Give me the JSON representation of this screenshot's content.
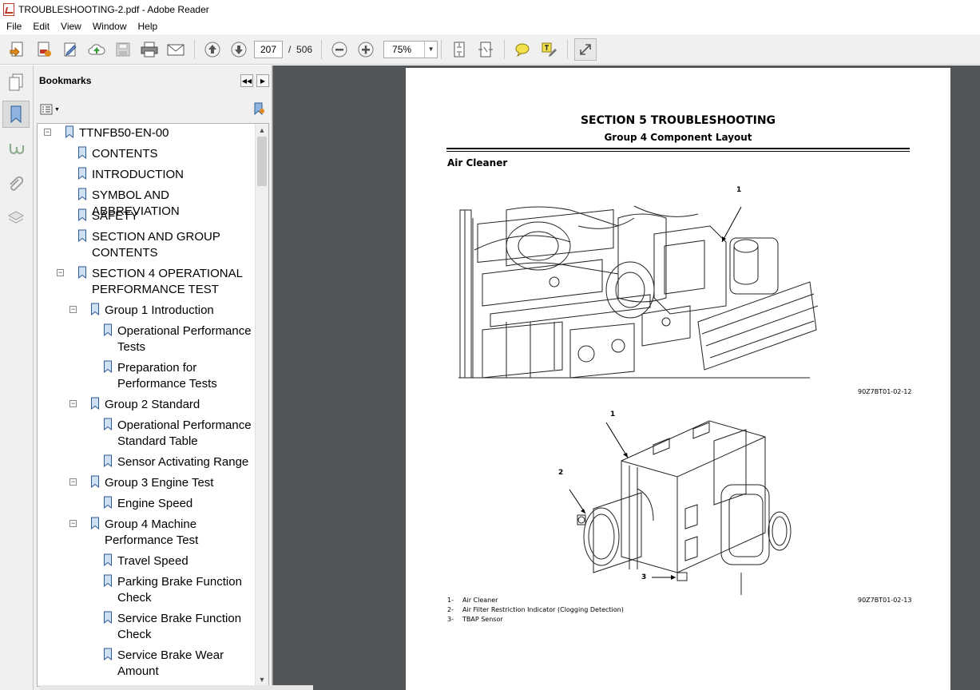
{
  "window": {
    "title": "TROUBLESHOOTING-2.pdf - Adobe Reader"
  },
  "menu": [
    "File",
    "Edit",
    "View",
    "Window",
    "Help"
  ],
  "toolbar": {
    "page_current": "207",
    "page_separator": "/",
    "page_total": "506",
    "zoom": "75%"
  },
  "bookmarks": {
    "title": "Bookmarks",
    "items": [
      {
        "label": "TTNFB50-EN-00"
      },
      {
        "label": "CONTENTS"
      },
      {
        "label": "INTRODUCTION"
      },
      {
        "label": "SYMBOL AND ABBREVIATION"
      },
      {
        "label": "SAFETY"
      },
      {
        "label": "SECTION AND GROUP",
        "label2": "CONTENTS"
      },
      {
        "label": "SECTION 4 OPERATIONAL",
        "label2": "PERFORMANCE TEST"
      },
      {
        "label": "Group 1 Introduction"
      },
      {
        "label": "Operational Performance",
        "label2": "Tests"
      },
      {
        "label": "Preparation for",
        "label2": "Performance Tests"
      },
      {
        "label": "Group 2 Standard"
      },
      {
        "label": "Operational Performance",
        "label2": "Standard Table"
      },
      {
        "label": "Sensor Activating Range"
      },
      {
        "label": "Group 3 Engine Test"
      },
      {
        "label": "Engine Speed"
      },
      {
        "label": "Group 4 Machine",
        "label2": "Performance Test"
      },
      {
        "label": "Travel Speed"
      },
      {
        "label": "Parking Brake Function",
        "label2": "Check"
      },
      {
        "label": "Service Brake Function",
        "label2": "Check"
      },
      {
        "label": "Service Brake Wear",
        "label2": "Amount"
      }
    ]
  },
  "document": {
    "section_title": "SECTION 5 TROUBLESHOOTING",
    "group_title": "Group 4 Component Layout",
    "subheading": "Air Cleaner",
    "figure1": {
      "code": "90Z7BT01-02-12",
      "callout": "1"
    },
    "figure2": {
      "code": "90Z7BT01-02-13",
      "callouts": [
        "1",
        "2",
        "3"
      ]
    },
    "legend": [
      {
        "num": "1-",
        "text": "Air Cleaner"
      },
      {
        "num": "2-",
        "text": "Air Filter Restriction Indicator (Clogging Detection)"
      },
      {
        "num": "3-",
        "text": "TBAP Sensor"
      }
    ]
  },
  "colors": {
    "accent_red": "#c0392b",
    "doc_background": "#525659",
    "toolbar_bg": "#f0f0f0"
  },
  "icons": [
    "create-pdf-icon",
    "export-icon",
    "edit-icon",
    "cloud-upload-icon",
    "save-icon",
    "print-icon",
    "email-icon",
    "prev-page-icon",
    "next-page-icon",
    "zoom-out-icon",
    "zoom-in-icon",
    "fit-page-icon",
    "fit-width-icon",
    "comment-icon",
    "highlight-icon",
    "expand-icon"
  ]
}
